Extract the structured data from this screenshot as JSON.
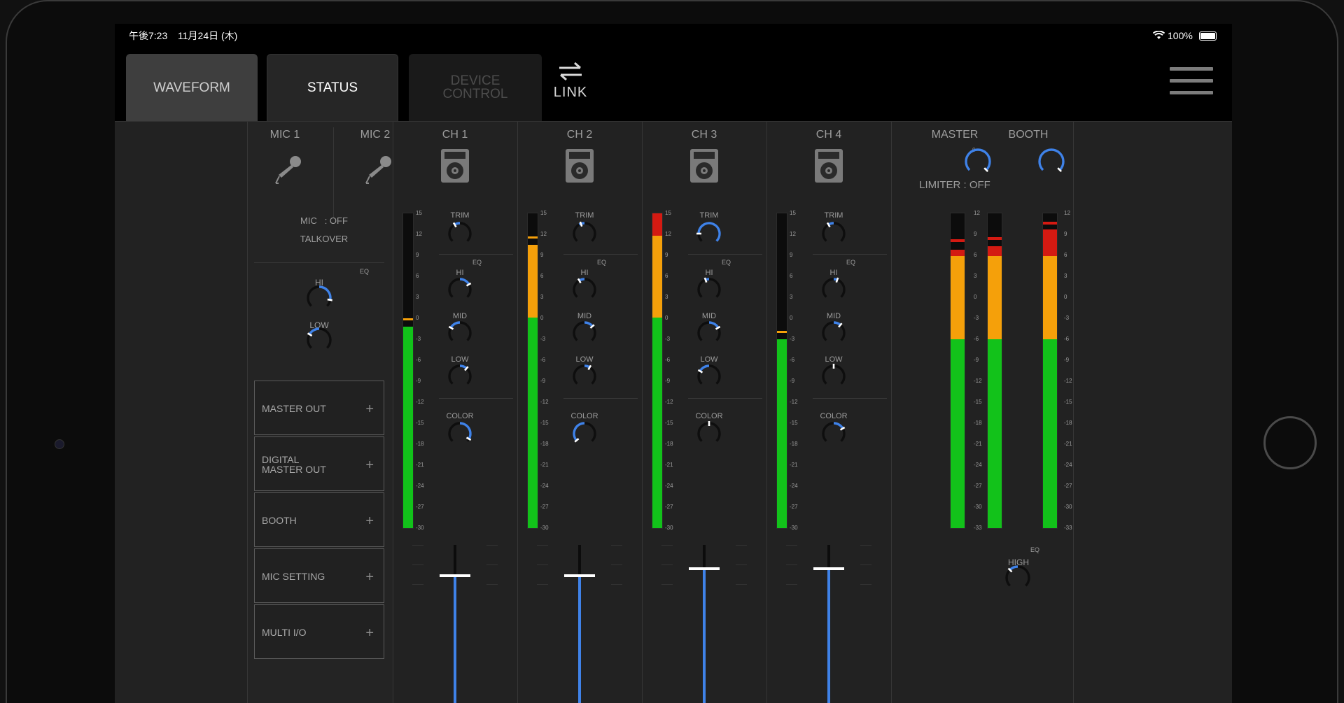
{
  "statusbar": {
    "time": "午後7:23",
    "date": "11月24日 (木)",
    "battery": "100%"
  },
  "tabs": [
    {
      "label": "WAVEFORM"
    },
    {
      "label": "STATUS"
    },
    {
      "label": "DEVICE\nCONTROL"
    }
  ],
  "link": {
    "label": "LINK",
    "icon": "swap-arrows-icon"
  },
  "menu": {
    "icon": "hamburger-menu-icon"
  },
  "mic": {
    "labels": [
      "MIC 1",
      "MIC 2"
    ],
    "mic_state": "MIC   : OFF",
    "talkover": "TALKOVER",
    "eq_label": "EQ",
    "hi_label": "HI",
    "low_label": "LOW"
  },
  "channels": [
    {
      "name": "CH 1",
      "level": 0.64
    },
    {
      "name": "CH 2",
      "level": 0.9
    },
    {
      "name": "CH 3",
      "level": 1.0
    },
    {
      "name": "CH 4",
      "level": 0.6
    }
  ],
  "channel_knobs": {
    "trim": "TRIM",
    "eq": "EQ",
    "hi": "HI",
    "mid": "MID",
    "low": "LOW",
    "color": "COLOR"
  },
  "meter_scale_ch": [
    "15",
    "12",
    "9",
    "6",
    "3",
    "0",
    "-3",
    "-6",
    "-9",
    "-12",
    "-15",
    "-18",
    "-21",
    "-24",
    "-27",
    "-30"
  ],
  "meter_scale_master": [
    "12",
    "9",
    "6",
    "3",
    "0",
    "-3",
    "-6",
    "-9",
    "-12",
    "-15",
    "-18",
    "-21",
    "-24",
    "-27",
    "-30",
    "-33"
  ],
  "master": {
    "label": "MASTER",
    "zero": "0",
    "limiter": "LIMITER : OFF"
  },
  "booth": {
    "label": "BOOTH"
  },
  "master_eq": {
    "eq": "EQ",
    "high": "HIGH"
  },
  "panels": [
    {
      "label": "MASTER OUT",
      "plus": "+"
    },
    {
      "label": "DIGITAL\nMASTER OUT",
      "plus": "+"
    },
    {
      "label": "BOOTH",
      "plus": "+"
    },
    {
      "label": "MIC SETTING",
      "plus": "+"
    },
    {
      "label": "MULTI I/O",
      "plus": "+"
    }
  ],
  "colors": {
    "green": "#12c21a",
    "orange": "#f5a00a",
    "red": "#d41a12",
    "blue": "#3f82e8"
  }
}
